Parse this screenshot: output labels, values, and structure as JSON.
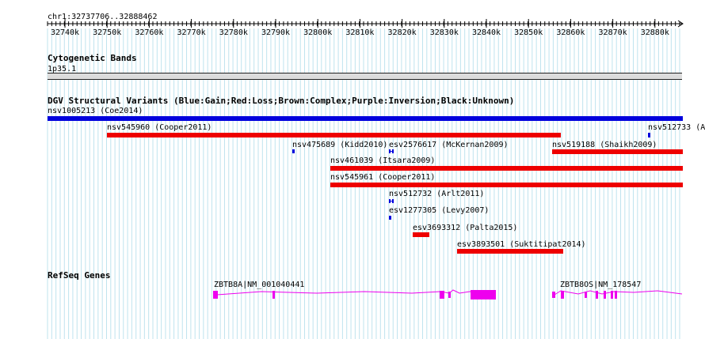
{
  "browser": {
    "region_label": "chr1:32737706..32888462",
    "ruler": {
      "ticks": [
        "32740k",
        "32750k",
        "32760k",
        "32770k",
        "32780k",
        "32790k",
        "32800k",
        "32810k",
        "32820k",
        "32830k",
        "32840k",
        "32850k",
        "32860k",
        "32870k",
        "32880k"
      ]
    },
    "tracks": {
      "cytobands": {
        "title": "Cytogenetic Bands",
        "band_label": "1p35.1"
      },
      "dgv": {
        "title": "DGV Structural Variants (Blue:Gain;Red:Loss;Brown:Complex;Purple:Inversion;Black:Unknown)",
        "colors": {
          "gain": "#0000dd",
          "loss": "#ee0000"
        },
        "features": [
          {
            "name": "nsv1005213 (Coe2014)",
            "type": "gain"
          },
          {
            "name": "nsv545960 (Cooper2011)",
            "type": "loss"
          },
          {
            "name": "nsv512733 (A",
            "type": "gain"
          },
          {
            "name": "nsv475689 (Kidd2010)",
            "type": "gain"
          },
          {
            "name": "esv2576617 (McKernan2009)",
            "type": "gain"
          },
          {
            "name": "nsv519188 (Shaikh2009)",
            "type": "loss"
          },
          {
            "name": "nsv461039 (Itsara2009)",
            "type": "loss"
          },
          {
            "name": "nsv545961 (Cooper2011)",
            "type": "loss"
          },
          {
            "name": "nsv512732 (Arlt2011)",
            "type": "gain"
          },
          {
            "name": "esv1277305 (Levy2007)",
            "type": "gain"
          },
          {
            "name": "esv3693312 (Palta2015)",
            "type": "loss"
          },
          {
            "name": "esv3893501 (Suktitipat2014)",
            "type": "loss"
          }
        ]
      },
      "refseq": {
        "title": "RefSeq Genes",
        "color": "#ee00ee",
        "genes": [
          {
            "name": "ZBTB8A|NM_001040441"
          },
          {
            "name": "ZBTB8OS|NM_178547"
          }
        ]
      }
    }
  }
}
